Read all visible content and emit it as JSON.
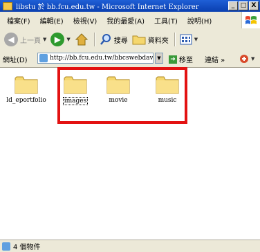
{
  "window": {
    "title": "libstu 於 bb.fcu.edu.tw - Microsoft Internet Explorer",
    "min_label": "_",
    "max_label": "□",
    "close_label": "X"
  },
  "menu": [
    "檔案(F)",
    "編輯(E)",
    "檢視(V)",
    "我的最愛(A)",
    "工具(T)",
    "說明(H)"
  ],
  "toolbar": {
    "back_label": "上一頁",
    "search_label": "搜尋",
    "folders_label": "資料夾"
  },
  "address": {
    "label": "網址(D)",
    "url": "http://bb.fcu.edu.tw/bbcswebdav/use",
    "go_label": "移至",
    "links_label": "連結 »"
  },
  "items": [
    {
      "label": "ld_eportfolio"
    },
    {
      "label": "images"
    },
    {
      "label": "movie"
    },
    {
      "label": "music"
    }
  ],
  "status": {
    "text": "4 個物件"
  },
  "colors": {
    "titlebar": "#0a3fb0",
    "highlight_box": "#e31212",
    "folder": "#f5d76e"
  }
}
